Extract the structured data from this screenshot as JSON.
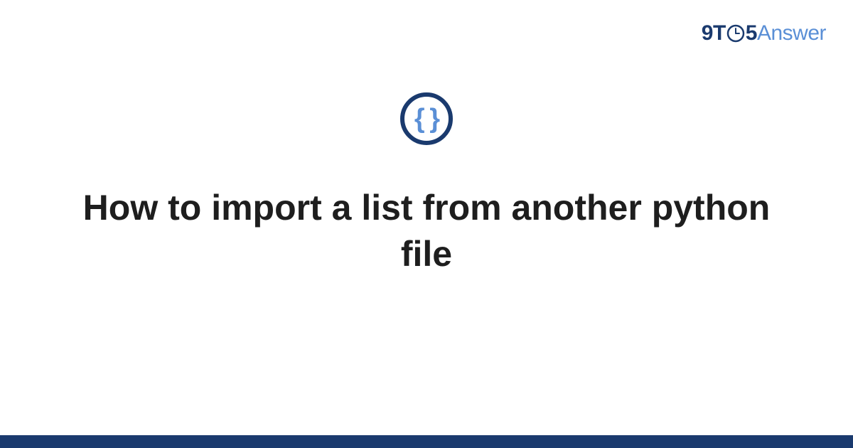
{
  "logo": {
    "part1": "9",
    "part2": "T",
    "part3": "5",
    "part4": "Answer"
  },
  "icon": {
    "braces": "{ }"
  },
  "title": "How to import a list from another python file"
}
